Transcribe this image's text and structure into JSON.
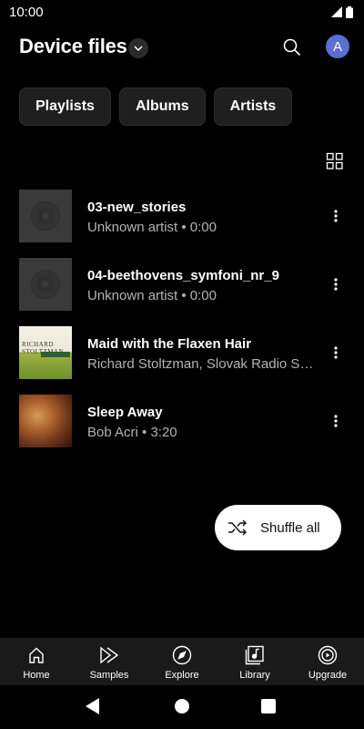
{
  "status_bar": {
    "time": "10:00"
  },
  "header": {
    "title": "Device files",
    "avatar_letter": "A"
  },
  "chips": [
    {
      "label": "Playlists"
    },
    {
      "label": "Albums"
    },
    {
      "label": "Artists"
    }
  ],
  "tracks": [
    {
      "title": "03-new_stories",
      "subtitle": "Unknown artist • 0:00",
      "art": "default-disc"
    },
    {
      "title": "04-beethovens_symfoni_nr_9",
      "subtitle": "Unknown artist • 0:00",
      "art": "default-disc"
    },
    {
      "title": "Maid with the Flaxen Hair",
      "subtitle": "Richard Stoltzman, Slovak Radio Sy…",
      "art": "album-art",
      "art_text": "RICHARD STOLTZMAN"
    },
    {
      "title": "Sleep Away",
      "subtitle": "Bob Acri • 3:20",
      "art": "album-art"
    }
  ],
  "shuffle": {
    "label": "Shuffle all"
  },
  "bottom_nav": [
    {
      "label": "Home",
      "icon": "home-icon"
    },
    {
      "label": "Samples",
      "icon": "samples-icon"
    },
    {
      "label": "Explore",
      "icon": "compass-icon"
    },
    {
      "label": "Library",
      "icon": "library-icon"
    },
    {
      "label": "Upgrade",
      "icon": "upgrade-icon"
    }
  ],
  "colors": {
    "background": "#000000",
    "avatar": "#5b6fd1",
    "chip_bg": "#1f1f1f",
    "nav_bg": "#1a1a1a",
    "secondary_text": "#b3b3b3"
  }
}
